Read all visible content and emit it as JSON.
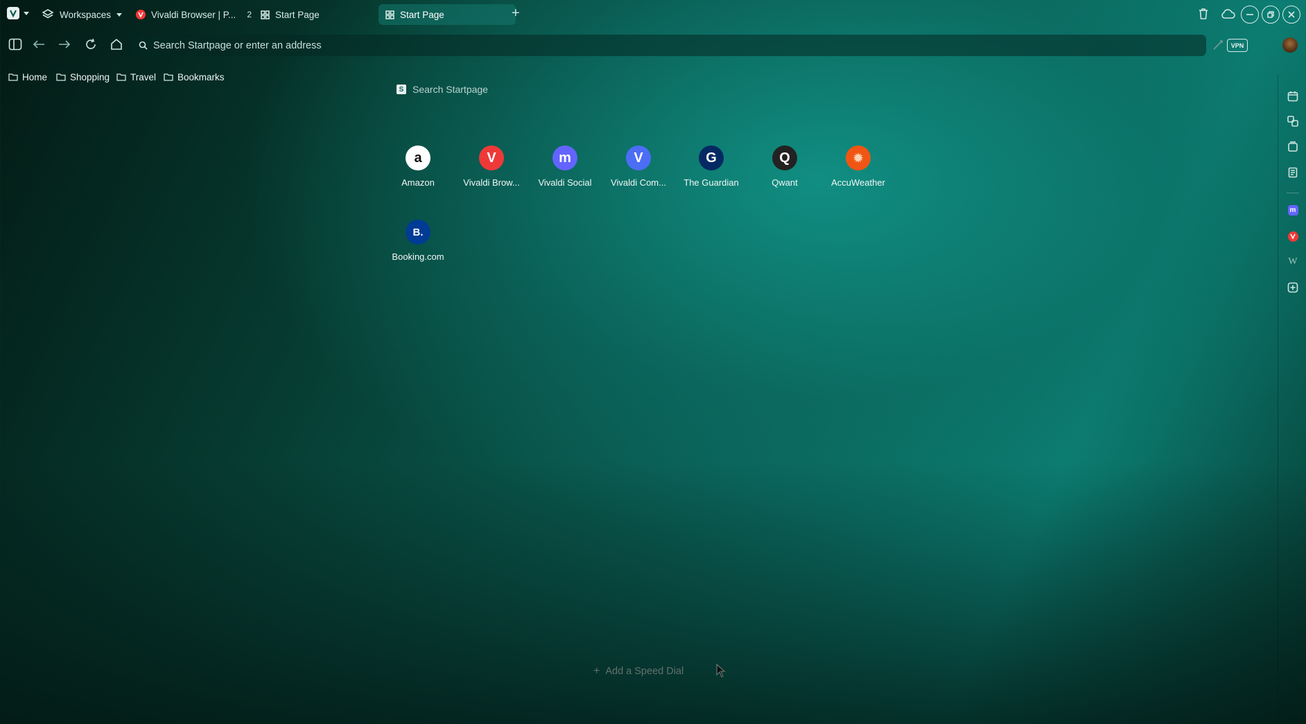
{
  "tabs": {
    "workspaces_label": "Workspaces",
    "tab1_title": "Vivaldi Browser | P...",
    "tab1_count": "2",
    "tab2_title": "Start Page",
    "tab3_title": "Start Page",
    "new_tab_symbol": "+"
  },
  "address_bar": {
    "placeholder": "Search Startpage or enter an address",
    "vpn_label": "VPN"
  },
  "bookmarks": [
    "Home",
    "Shopping",
    "Travel",
    "Bookmarks"
  ],
  "start_page": {
    "search_placeholder": "Search Startpage",
    "speed_dials": [
      {
        "label": "Amazon",
        "glyph": "a",
        "bg": "#ffffff",
        "fg": "#111111"
      },
      {
        "label": "Vivaldi Brow...",
        "glyph": "V",
        "bg": "#ef3939",
        "fg": "#ffffff"
      },
      {
        "label": "Vivaldi Social",
        "glyph": "m",
        "bg": "#6364ff",
        "fg": "#ffffff"
      },
      {
        "label": "Vivaldi Com...",
        "glyph": "V",
        "bg": "#4c6df5",
        "fg": "#ffffff"
      },
      {
        "label": "The Guardian",
        "glyph": "G",
        "bg": "#052962",
        "fg": "#ffffff"
      },
      {
        "label": "Qwant",
        "glyph": "Q",
        "bg": "#222222",
        "fg": "#ffffff"
      },
      {
        "label": "AccuWeather",
        "glyph": "✹",
        "bg": "#f05514",
        "fg": "#ffd2b5"
      },
      {
        "label": "Booking.com",
        "glyph": "B.",
        "bg": "#003b95",
        "fg": "#ffffff"
      }
    ],
    "add_speed_dial": "Add a Speed Dial",
    "add_symbol": "+"
  }
}
